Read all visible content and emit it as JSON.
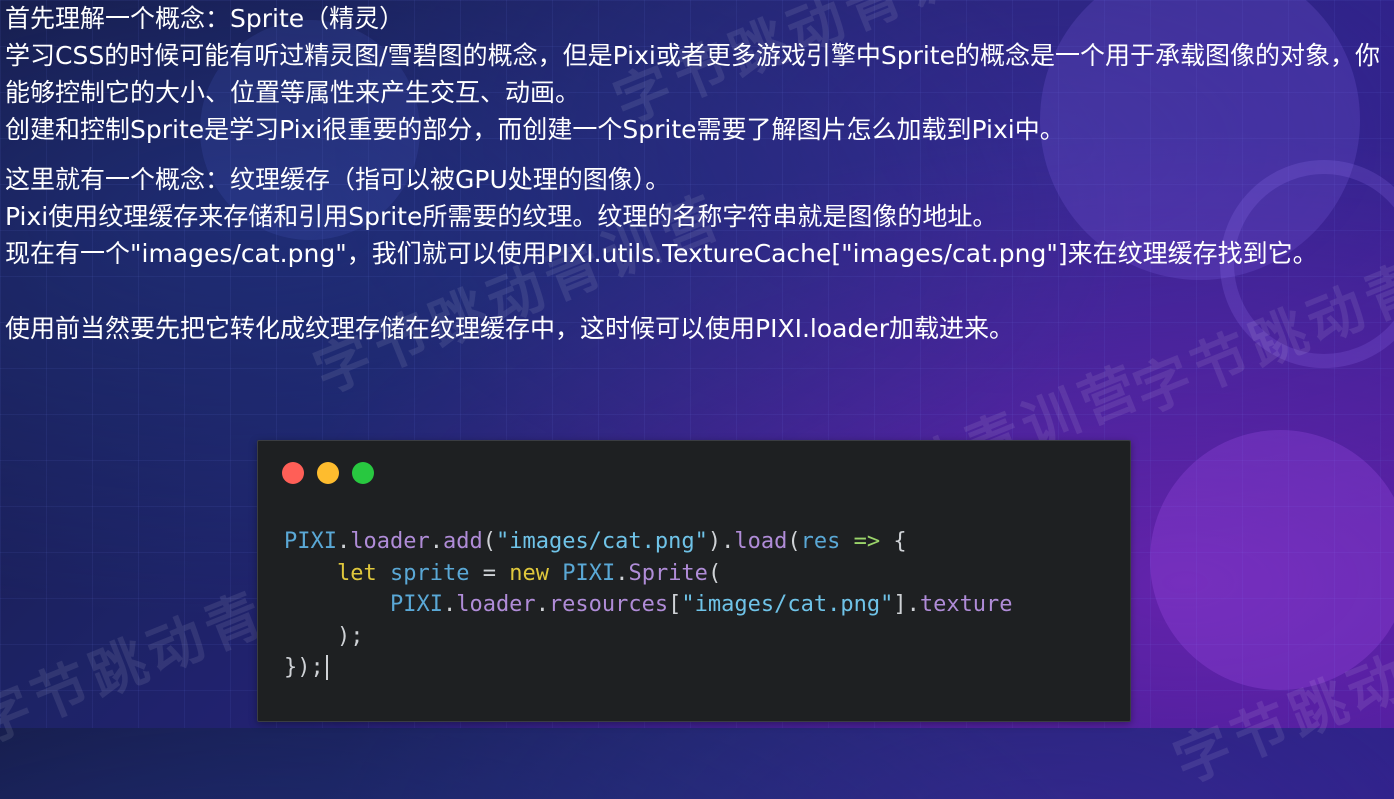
{
  "paragraph1": [
    "首先理解一个概念：Sprite（精灵）",
    "学习CSS的时候可能有听过精灵图/雪碧图的概念，但是Pixi或者更多游戏引擎中Sprite的概念是一个用于承载图像的对象，你能够控制它的大小、位置等属性来产生交互、动画。",
    "创建和控制Sprite是学习Pixi很重要的部分，而创建一个Sprite需要了解图片怎么加载到Pixi中。"
  ],
  "paragraph2": [
    "这里就有一个概念：纹理缓存（指可以被GPU处理的图像）。",
    "Pixi使用纹理缓存来存储和引用Sprite所需要的纹理。纹理的名称字符串就是图像的地址。",
    "现在有一个\"images/cat.png\"，我们就可以使用PIXI.utils.TextureCache[\"images/cat.png\"]来在纹理缓存找到它。"
  ],
  "paragraph3": "使用前当然要先把它转化成纹理存储在纹理缓存中，这时候可以使用PIXI.loader加载进来。",
  "watermark_text": "字节跳动青训营",
  "window_dots": [
    {
      "color": "#ff5f57",
      "icon": "close-dot-icon"
    },
    {
      "color": "#febc2e",
      "icon": "minimize-dot-icon"
    },
    {
      "color": "#28c840",
      "icon": "maximize-dot-icon"
    }
  ],
  "code_lines": [
    [
      [
        "PIXI",
        "#5aa8d6"
      ],
      [
        ".",
        "#cfd2d6"
      ],
      [
        "loader",
        "#b08cd8"
      ],
      [
        ".",
        "#cfd2d6"
      ],
      [
        "add",
        "#b08cd8"
      ],
      [
        "(",
        "#cfd2d6"
      ],
      [
        "\"images/cat.png\"",
        "#6fc3e8"
      ],
      [
        ").",
        "#cfd2d6"
      ],
      [
        "load",
        "#b08cd8"
      ],
      [
        "(",
        "#cfd2d6"
      ],
      [
        "res",
        "#5aa8d6"
      ],
      [
        " ",
        "#cfd2d6"
      ],
      [
        "=>",
        "#9bd46a"
      ],
      [
        " {",
        "#cfd2d6"
      ]
    ],
    [
      [
        "    ",
        "#cfd2d6"
      ],
      [
        "let",
        "#e0c83c"
      ],
      [
        " ",
        "#cfd2d6"
      ],
      [
        "sprite",
        "#5aa8d6"
      ],
      [
        " = ",
        "#cfd2d6"
      ],
      [
        "new",
        "#e0c83c"
      ],
      [
        " ",
        "#cfd2d6"
      ],
      [
        "PIXI",
        "#5aa8d6"
      ],
      [
        ".",
        "#cfd2d6"
      ],
      [
        "Sprite",
        "#b08cd8"
      ],
      [
        "(",
        "#cfd2d6"
      ]
    ],
    [
      [
        "        ",
        "#cfd2d6"
      ],
      [
        "PIXI",
        "#5aa8d6"
      ],
      [
        ".",
        "#cfd2d6"
      ],
      [
        "loader",
        "#b08cd8"
      ],
      [
        ".",
        "#cfd2d6"
      ],
      [
        "resources",
        "#b08cd8"
      ],
      [
        "[",
        "#cfd2d6"
      ],
      [
        "\"images/cat.png\"",
        "#6fc3e8"
      ],
      [
        "].",
        "#cfd2d6"
      ],
      [
        "texture",
        "#b08cd8"
      ]
    ],
    [
      [
        "    );",
        "#cfd2d6"
      ]
    ],
    [
      [
        "});",
        "#cfd2d6"
      ]
    ]
  ]
}
